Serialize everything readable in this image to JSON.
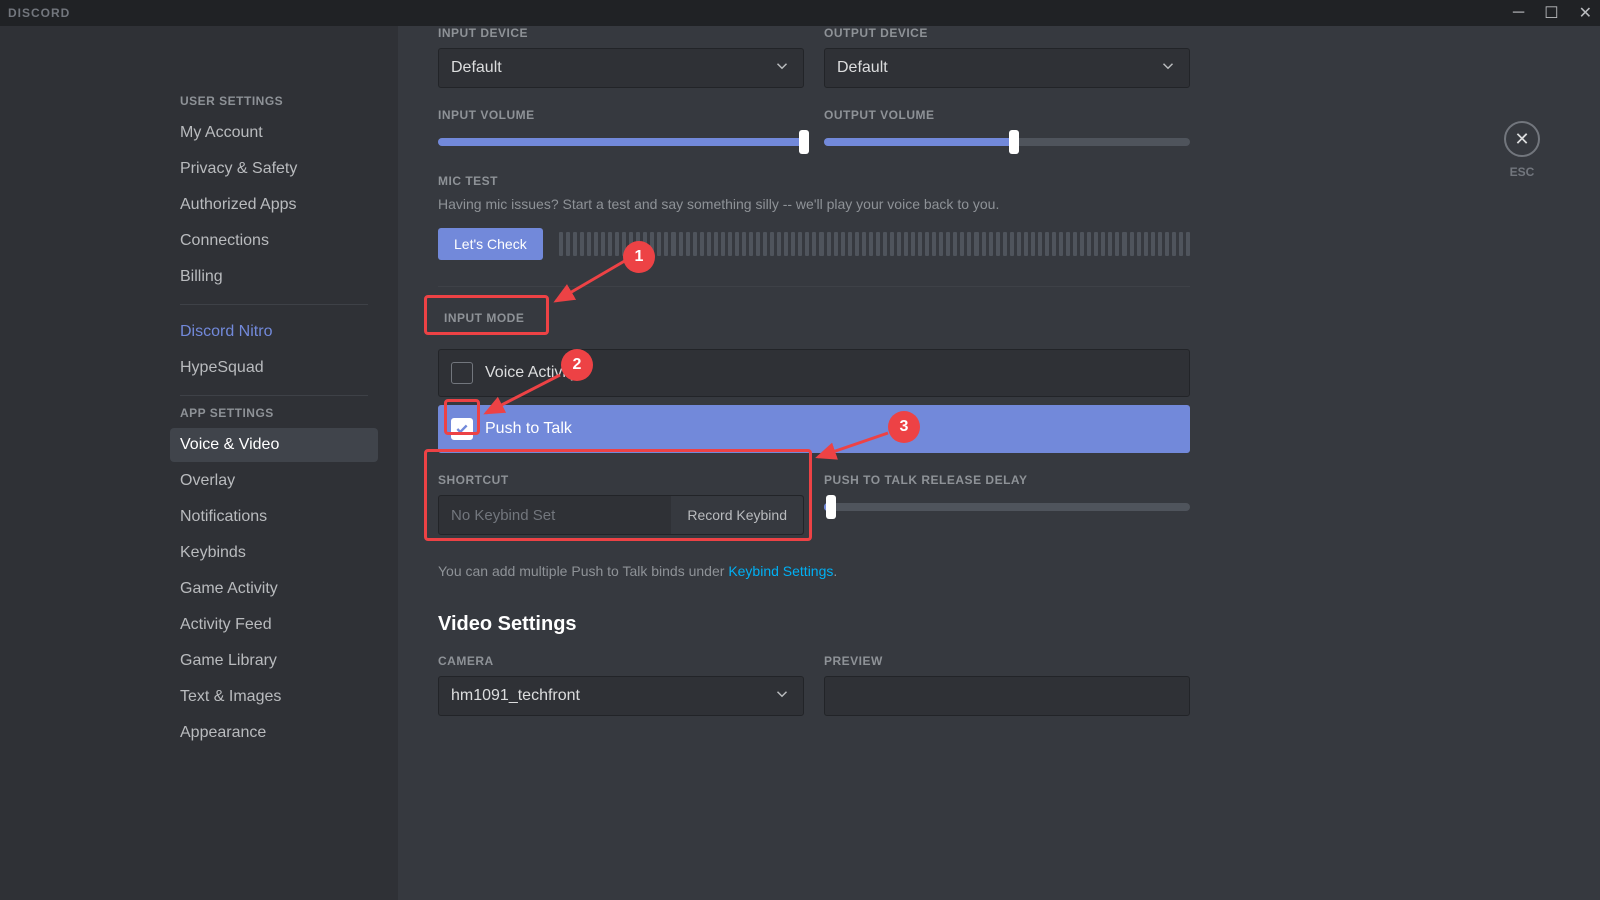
{
  "titlebar": {
    "app": "DISCORD"
  },
  "close": {
    "esc": "ESC"
  },
  "sidebar": {
    "section_user": "User Settings",
    "section_app": "App Settings",
    "items_user": [
      {
        "label": "My Account"
      },
      {
        "label": "Privacy & Safety"
      },
      {
        "label": "Authorized Apps"
      },
      {
        "label": "Connections"
      },
      {
        "label": "Billing"
      }
    ],
    "items_nitro": [
      {
        "label": "Discord Nitro"
      },
      {
        "label": "HypeSquad"
      }
    ],
    "items_app": [
      {
        "label": "Voice & Video"
      },
      {
        "label": "Overlay"
      },
      {
        "label": "Notifications"
      },
      {
        "label": "Keybinds"
      },
      {
        "label": "Game Activity"
      },
      {
        "label": "Activity Feed"
      },
      {
        "label": "Game Library"
      },
      {
        "label": "Text & Images"
      },
      {
        "label": "Appearance"
      }
    ]
  },
  "voice": {
    "input_device_label": "Input Device",
    "output_device_label": "Output Device",
    "input_device_value": "Default",
    "output_device_value": "Default",
    "input_volume_label": "Input Volume",
    "output_volume_label": "Output Volume",
    "input_volume_pct": 100,
    "output_volume_pct": 52,
    "mic_test_label": "Mic Test",
    "mic_test_hint": "Having mic issues? Start a test and say something silly -- we'll play your voice back to you.",
    "lets_check": "Let's Check",
    "input_mode_label": "Input Mode",
    "mode_voice_activity": "Voice Activity",
    "mode_ptt": "Push to Talk",
    "shortcut_label": "Shortcut",
    "shortcut_value": "No Keybind Set",
    "record_keybind": "Record Keybind",
    "ptt_delay_label": "Push to Talk Release Delay",
    "ptt_delay_pct": 2,
    "keybind_info_pre": "You can add multiple Push to Talk binds under ",
    "keybind_info_link": "Keybind Settings",
    "keybind_info_post": ".",
    "video_settings": "Video Settings",
    "camera_label": "Camera",
    "camera_value": "hm1091_techfront",
    "preview_label": "Preview"
  },
  "annotations": {
    "n1": "1",
    "n2": "2",
    "n3": "3"
  }
}
